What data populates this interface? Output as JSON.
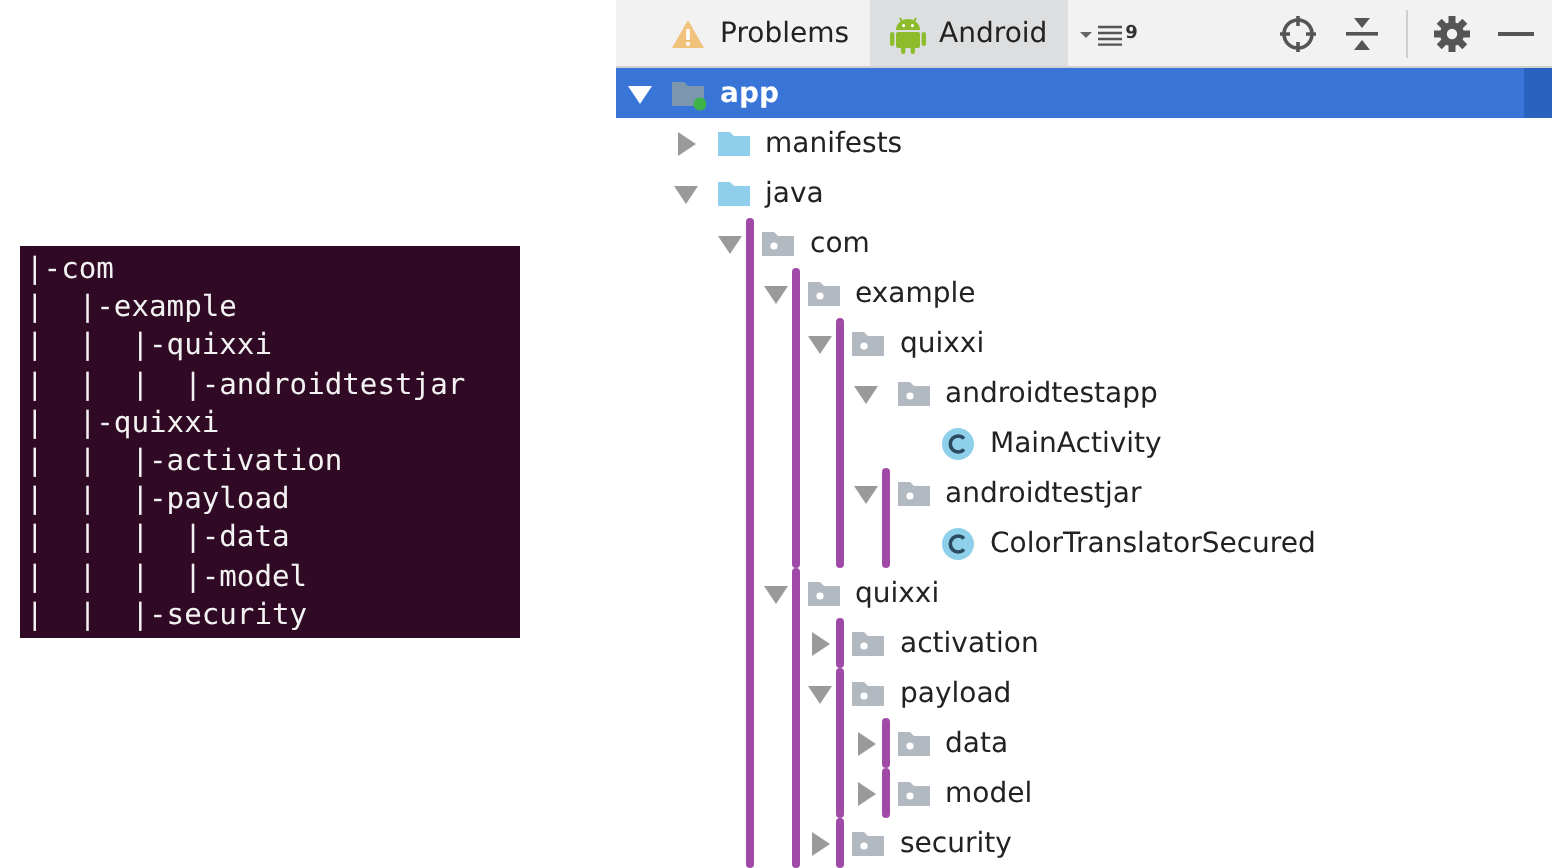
{
  "terminal": {
    "lines": [
      "|-com",
      "|  |-example",
      "|  |  |-quixxi",
      "|  |  |  |-androidtestjar",
      "|  |-quixxi",
      "|  |  |-activation",
      "|  |  |-payload",
      "|  |  |  |-data",
      "|  |  |  |-model",
      "|  |  |-security"
    ]
  },
  "toolbar": {
    "tabs": [
      {
        "label": "Problems",
        "kind": "problems",
        "selected": false
      },
      {
        "label": "Android",
        "kind": "android",
        "selected": true
      }
    ],
    "view_count": "9"
  },
  "tree": [
    {
      "label": "app",
      "kind": "module",
      "expanded": true,
      "selected": true,
      "marked": false,
      "children": [
        {
          "label": "manifests",
          "kind": "folder",
          "expanded": false,
          "selected": false,
          "marked": false
        },
        {
          "label": "java",
          "kind": "folder",
          "expanded": true,
          "selected": false,
          "marked": false,
          "children": [
            {
              "label": "com",
              "kind": "package",
              "expanded": true,
              "selected": false,
              "marked": true,
              "children": [
                {
                  "label": "example",
                  "kind": "package",
                  "expanded": true,
                  "selected": false,
                  "marked": true,
                  "children": [
                    {
                      "label": "quixxi",
                      "kind": "package",
                      "expanded": true,
                      "selected": false,
                      "marked": true,
                      "children": [
                        {
                          "label": "androidtestapp",
                          "kind": "package",
                          "expanded": true,
                          "selected": false,
                          "marked": false,
                          "children": [
                            {
                              "label": "MainActivity",
                              "kind": "class",
                              "selected": false,
                              "marked": false
                            }
                          ]
                        },
                        {
                          "label": "androidtestjar",
                          "kind": "package",
                          "expanded": true,
                          "selected": false,
                          "marked": true,
                          "children": [
                            {
                              "label": "ColorTranslatorSecured",
                              "kind": "class",
                              "selected": false,
                              "marked": false
                            }
                          ]
                        }
                      ]
                    }
                  ]
                },
                {
                  "label": "quixxi",
                  "kind": "package",
                  "expanded": true,
                  "selected": false,
                  "marked": true,
                  "children": [
                    {
                      "label": "activation",
                      "kind": "package",
                      "expanded": false,
                      "selected": false,
                      "marked": true
                    },
                    {
                      "label": "payload",
                      "kind": "package",
                      "expanded": true,
                      "selected": false,
                      "marked": true,
                      "children": [
                        {
                          "label": "data",
                          "kind": "package",
                          "expanded": false,
                          "selected": false,
                          "marked": true
                        },
                        {
                          "label": "model",
                          "kind": "package",
                          "expanded": false,
                          "selected": false,
                          "marked": true
                        }
                      ]
                    },
                    {
                      "label": "security",
                      "kind": "package",
                      "expanded": false,
                      "selected": false,
                      "marked": true
                    }
                  ]
                }
              ]
            }
          ]
        }
      ]
    }
  ]
}
